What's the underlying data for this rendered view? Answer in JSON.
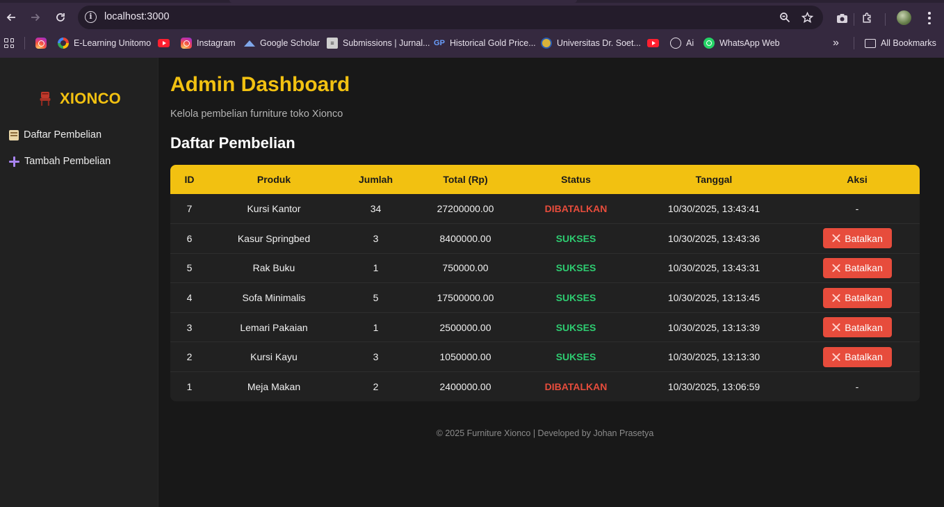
{
  "browser": {
    "url": "localhost:3000",
    "bookmarks": [
      {
        "label": "",
        "icon": "instagram-icon"
      },
      {
        "label": "E-Learning Unitomo",
        "icon": "google-icon"
      },
      {
        "label": "",
        "icon": "youtube-icon"
      },
      {
        "label": "Instagram",
        "icon": "instagram-icon"
      },
      {
        "label": "Google Scholar",
        "icon": "google-scholar-icon"
      },
      {
        "label": "Submissions | Jurnal...",
        "icon": "jurnal-icon"
      },
      {
        "label": "Historical Gold Price...",
        "icon": "gp-icon"
      },
      {
        "label": "Universitas Dr. Soet...",
        "icon": "university-icon"
      },
      {
        "label": "",
        "icon": "youtube-icon"
      },
      {
        "label": "Ai",
        "icon": "openai-icon"
      },
      {
        "label": "WhatsApp Web",
        "icon": "whatsapp-icon"
      }
    ],
    "all_bookmarks_label": "All Bookmarks",
    "overflow_label": "»"
  },
  "sidebar": {
    "brand": "XIONCO",
    "items": [
      {
        "label": "Daftar Pembelian",
        "icon": "clipboard-icon"
      },
      {
        "label": "Tambah Pembelian",
        "icon": "plus-icon"
      }
    ]
  },
  "main": {
    "title": "Admin Dashboard",
    "subtitle": "Kelola pembelian furniture toko Xionco",
    "section_title": "Daftar Pembelian",
    "table": {
      "headers": [
        "ID",
        "Produk",
        "Jumlah",
        "Total (Rp)",
        "Status",
        "Tanggal",
        "Aksi"
      ],
      "rows": [
        {
          "id": "7",
          "produk": "Kursi Kantor",
          "jumlah": "34",
          "total": "27200000.00",
          "status": "DIBATALKAN",
          "tanggal": "10/30/2025, 13:43:41",
          "aksi": "-"
        },
        {
          "id": "6",
          "produk": "Kasur Springbed",
          "jumlah": "3",
          "total": "8400000.00",
          "status": "SUKSES",
          "tanggal": "10/30/2025, 13:43:36",
          "aksi": "Batalkan"
        },
        {
          "id": "5",
          "produk": "Rak Buku",
          "jumlah": "1",
          "total": "750000.00",
          "status": "SUKSES",
          "tanggal": "10/30/2025, 13:43:31",
          "aksi": "Batalkan"
        },
        {
          "id": "4",
          "produk": "Sofa Minimalis",
          "jumlah": "5",
          "total": "17500000.00",
          "status": "SUKSES",
          "tanggal": "10/30/2025, 13:13:45",
          "aksi": "Batalkan"
        },
        {
          "id": "3",
          "produk": "Lemari Pakaian",
          "jumlah": "1",
          "total": "2500000.00",
          "status": "SUKSES",
          "tanggal": "10/30/2025, 13:13:39",
          "aksi": "Batalkan"
        },
        {
          "id": "2",
          "produk": "Kursi Kayu",
          "jumlah": "3",
          "total": "1050000.00",
          "status": "SUKSES",
          "tanggal": "10/30/2025, 13:13:30",
          "aksi": "Batalkan"
        },
        {
          "id": "1",
          "produk": "Meja Makan",
          "jumlah": "2",
          "total": "2400000.00",
          "status": "DIBATALKAN",
          "tanggal": "10/30/2025, 13:06:59",
          "aksi": "-"
        }
      ]
    },
    "footer": "© 2025 Furniture Xionco | Developed by Johan Prasetya"
  },
  "colors": {
    "accent": "#f2c111",
    "danger": "#e74c3c",
    "success": "#2ecc71",
    "background": "#181818",
    "sidebar": "#212121"
  }
}
